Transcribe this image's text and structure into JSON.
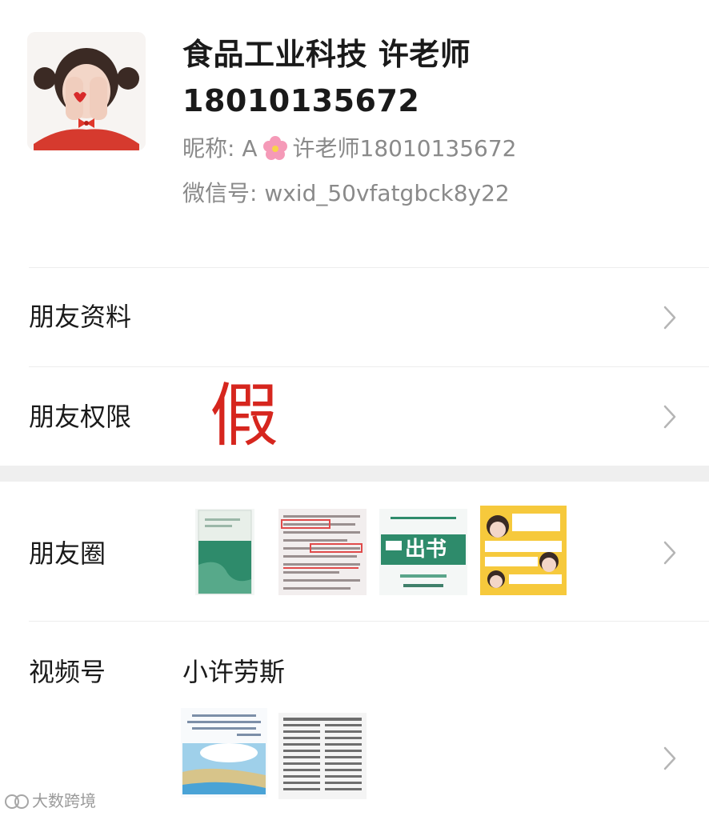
{
  "profile": {
    "name": "食品工业科技 许老师",
    "phone": "18010135672",
    "nickname_label": "昵称: A",
    "nickname_value": "许老师18010135672",
    "wechat_id": "微信号: wxid_50vfatgbck8y22",
    "flower_icon": "cherry-blossom-icon"
  },
  "menu": {
    "friend_info": "朋友资料",
    "friend_permissions": "朋友权限",
    "fake_stamp": "假",
    "moments": "朋友圈",
    "channels": "视频号",
    "channel_name": "小许劳斯"
  },
  "moments_thumbs": {
    "chushu_badge": "出书"
  },
  "watermark": {
    "text": "大数跨境"
  },
  "colors": {
    "fake_red": "#d6261e",
    "section_gap": "#efefef",
    "secondary_text": "#8a8a8a",
    "book_green": "#2e8b6b"
  }
}
